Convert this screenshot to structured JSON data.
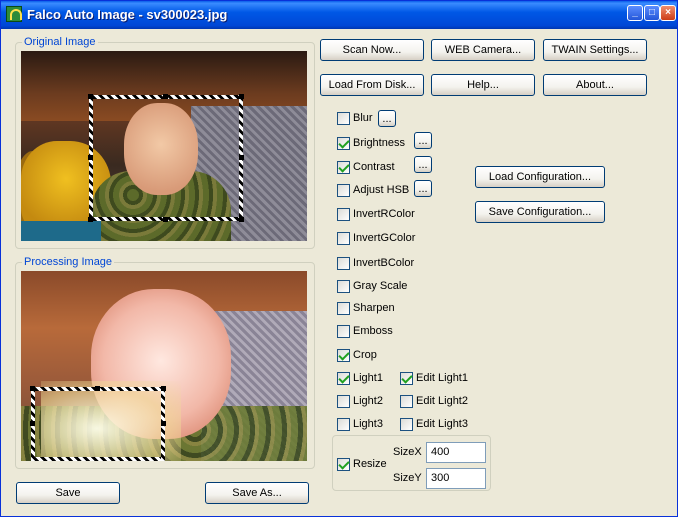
{
  "window": {
    "title": "Falco Auto Image - sv300023.jpg",
    "controls": [
      "minimize-icon",
      "maximize-icon",
      "close-icon"
    ]
  },
  "groups": {
    "original": "Original Image",
    "processing": "Processing Image"
  },
  "top_buttons": {
    "scan_now": "Scan Now...",
    "web_camera": "WEB Camera...",
    "twain": "TWAIN Settings...",
    "load_disk": "Load From Disk...",
    "help": "Help...",
    "about": "About..."
  },
  "filters": {
    "blur": {
      "label": "Blur",
      "checked": false
    },
    "brightness": {
      "label": "Brightness",
      "checked": true
    },
    "contrast": {
      "label": "Contrast",
      "checked": true
    },
    "adjust_hsb": {
      "label": "Adjust HSB",
      "checked": false
    },
    "invert_r": {
      "label": "InvertRColor",
      "checked": false
    },
    "invert_g": {
      "label": "InvertGColor",
      "checked": false
    },
    "invert_b": {
      "label": "InvertBColor",
      "checked": false
    },
    "gray_scale": {
      "label": "Gray Scale",
      "checked": false
    },
    "sharpen": {
      "label": "Sharpen",
      "checked": false
    },
    "emboss": {
      "label": "Emboss",
      "checked": false
    },
    "crop": {
      "label": "Crop",
      "checked": true
    },
    "light1": {
      "label": "Light1",
      "checked": true
    },
    "light2": {
      "label": "Light2",
      "checked": false
    },
    "light3": {
      "label": "Light3",
      "checked": false
    },
    "edit_light1": {
      "label": "Edit Light1",
      "checked": true
    },
    "edit_light2": {
      "label": "Edit Light2",
      "checked": false
    },
    "edit_light3": {
      "label": "Edit Light3",
      "checked": false
    },
    "resize": {
      "label": "Resize",
      "checked": true
    }
  },
  "ellipsis_label": "...",
  "config_buttons": {
    "load": "Load Configuration...",
    "save": "Save Configuration..."
  },
  "resize": {
    "sizex_label": "SizeX",
    "sizex_value": "400",
    "sizey_label": "SizeY",
    "sizey_value": "300"
  },
  "bottom_buttons": {
    "save": "Save",
    "save_as": "Save As..."
  }
}
